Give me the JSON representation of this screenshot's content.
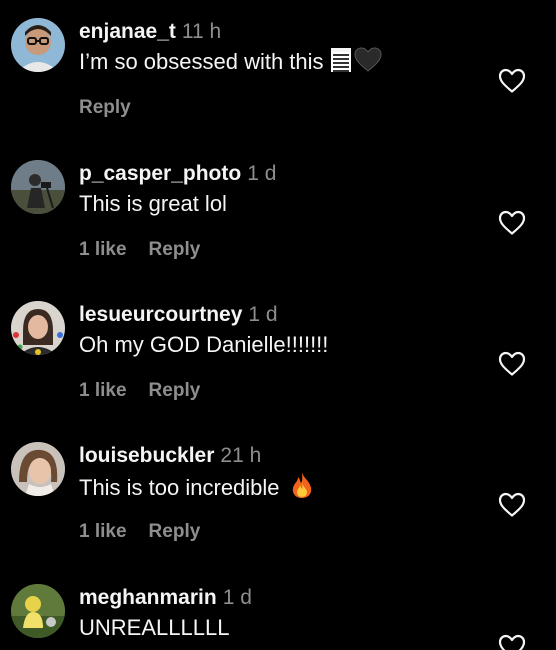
{
  "comments": [
    {
      "username": "enjanae_t",
      "time": "11 h",
      "text": "I’m so obsessed with this",
      "emoji": [
        "notepad-emoji",
        "black-heart-emoji"
      ],
      "likes": "",
      "reply_label": "Reply",
      "like_icon": "heart-outline-icon"
    },
    {
      "username": "p_casper_photo",
      "time": "1 d",
      "text": "This is great lol",
      "emoji": [],
      "likes": "1 like",
      "reply_label": "Reply",
      "like_icon": "heart-outline-icon"
    },
    {
      "username": "lesueurcourtney",
      "time": "1 d",
      "text": "Oh my GOD Danielle!!!!!!!",
      "emoji": [],
      "likes": "1 like",
      "reply_label": "Reply",
      "like_icon": "heart-outline-icon"
    },
    {
      "username": "louisebuckler",
      "time": "21 h",
      "text": "This is too incredible",
      "emoji": [
        "fire-emoji"
      ],
      "likes": "1 like",
      "reply_label": "Reply",
      "like_icon": "heart-outline-icon"
    },
    {
      "username": "meghanmarin",
      "time": "1 d",
      "text": "UNREALLLLLL",
      "emoji": [],
      "likes": "",
      "reply_label": "",
      "like_icon": "heart-outline-icon"
    }
  ],
  "colors": {
    "background": "#000000",
    "primary_text": "#f5f5f5",
    "secondary_text": "#8e8e8e"
  }
}
